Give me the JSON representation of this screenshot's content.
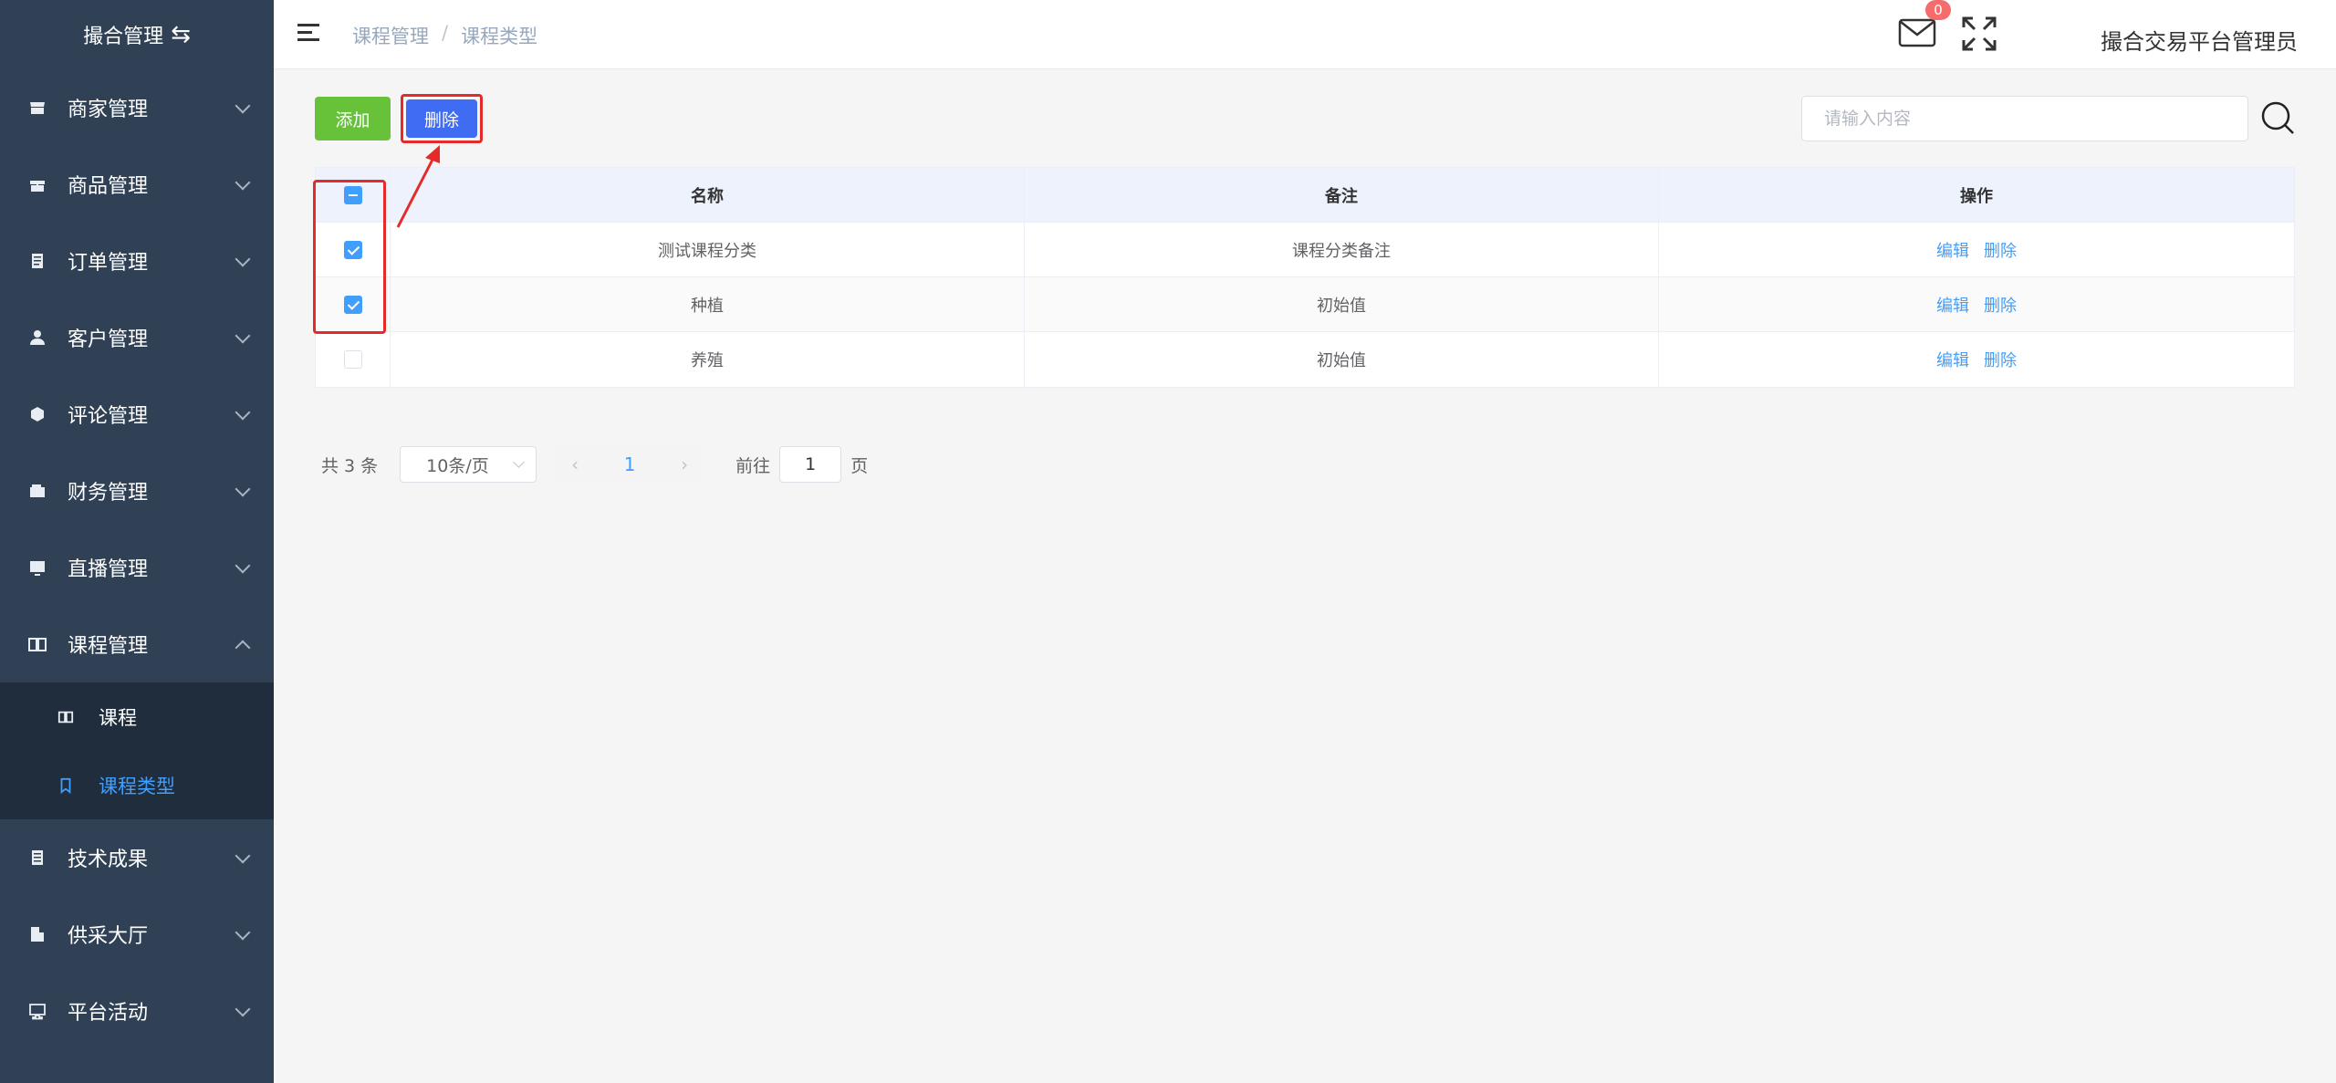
{
  "sidebar": {
    "brand": "撮合管理",
    "brand_icon": "swap-icon",
    "items": [
      {
        "label": "商家管理",
        "icon": "store-icon"
      },
      {
        "label": "商品管理",
        "icon": "gift-icon"
      },
      {
        "label": "订单管理",
        "icon": "order-icon"
      },
      {
        "label": "客户管理",
        "icon": "user-icon"
      },
      {
        "label": "评论管理",
        "icon": "comment-icon"
      },
      {
        "label": "财务管理",
        "icon": "wallet-icon"
      },
      {
        "label": "直播管理",
        "icon": "live-icon"
      },
      {
        "label": "课程管理",
        "icon": "book-icon",
        "open": true
      }
    ],
    "submenu": [
      {
        "label": "课程",
        "icon": "book-open-icon"
      },
      {
        "label": "课程类型",
        "icon": "bookmark-icon",
        "active": true
      }
    ],
    "items_after": [
      {
        "label": "技术成果",
        "icon": "document-icon"
      },
      {
        "label": "供采大厅",
        "icon": "building-icon"
      },
      {
        "label": "平台活动",
        "icon": "monitor-icon"
      }
    ]
  },
  "header": {
    "breadcrumb": [
      "课程管理",
      "课程类型"
    ],
    "breadcrumb_sep": "/",
    "mail_badge": "0",
    "admin_name": "撮合交易平台管理员"
  },
  "toolbar": {
    "add_label": "添加",
    "delete_label": "删除",
    "search_placeholder": "请输入内容"
  },
  "table": {
    "columns": [
      "名称",
      "备注",
      "操作"
    ],
    "rows": [
      {
        "name": "测试课程分类",
        "note": "课程分类备注",
        "checked": true,
        "edit": "编辑",
        "delete": "删除"
      },
      {
        "name": "种植",
        "note": "初始值",
        "checked": true,
        "edit": "编辑",
        "delete": "删除"
      },
      {
        "name": "养殖",
        "note": "初始值",
        "checked": false,
        "edit": "编辑",
        "delete": "删除"
      }
    ]
  },
  "pagination": {
    "total": "共 3 条",
    "page_size": "10条/页",
    "current_page": "1",
    "goto_label": "前往",
    "goto_value": "1",
    "goto_suffix": "页"
  },
  "colors": {
    "sidebar_bg": "#304156",
    "submenu_bg": "#1f2d3d",
    "accent": "#409eff",
    "add_button": "#67c23a",
    "delete_button": "#3f6cf2",
    "highlight": "#e52a2a",
    "badge": "#f56c6c"
  }
}
